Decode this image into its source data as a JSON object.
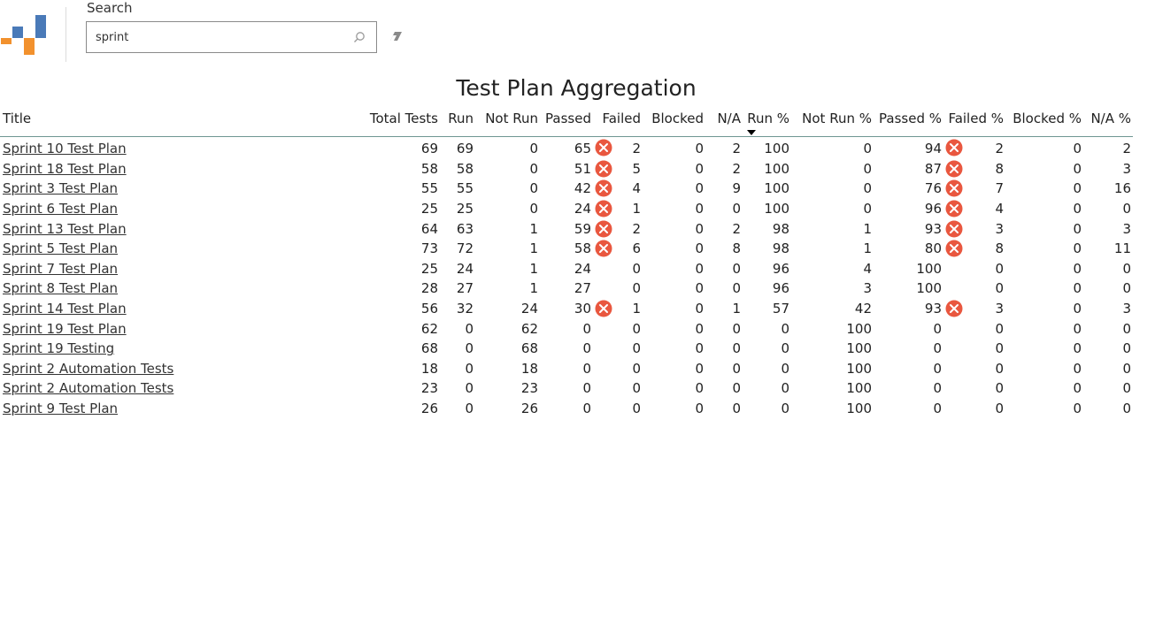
{
  "search": {
    "label": "Search",
    "value": "sprint"
  },
  "report": {
    "title": "Test Plan Aggregation"
  },
  "colors": {
    "logo_blue": "#4a7ab8",
    "logo_orange": "#f2912d",
    "fail_icon": "#e9573f",
    "header_rule": "#6f9693"
  },
  "table": {
    "sorted_column": "Run %",
    "columns": [
      "Title",
      "Total Tests",
      "Run",
      "Not Run",
      "Passed",
      "Failed",
      "Blocked",
      "N/A",
      "Run %",
      "Not Run %",
      "Passed %",
      "Failed %",
      "Blocked %",
      "N/A %"
    ],
    "rows": [
      {
        "title": "Sprint 10 Test Plan",
        "total": "69",
        "run": "69",
        "not_run": "0",
        "passed": "65",
        "failed": "2",
        "blocked": "0",
        "na": "2",
        "run_pct": "100",
        "not_run_pct": "0",
        "passed_pct": "94",
        "failed_pct": "2",
        "blocked_pct": "0",
        "na_pct": "2",
        "fail_icon": true
      },
      {
        "title": "Sprint 18 Test Plan",
        "total": "58",
        "run": "58",
        "not_run": "0",
        "passed": "51",
        "failed": "5",
        "blocked": "0",
        "na": "2",
        "run_pct": "100",
        "not_run_pct": "0",
        "passed_pct": "87",
        "failed_pct": "8",
        "blocked_pct": "0",
        "na_pct": "3",
        "fail_icon": true
      },
      {
        "title": "Sprint 3 Test Plan",
        "total": "55",
        "run": "55",
        "not_run": "0",
        "passed": "42",
        "failed": "4",
        "blocked": "0",
        "na": "9",
        "run_pct": "100",
        "not_run_pct": "0",
        "passed_pct": "76",
        "failed_pct": "7",
        "blocked_pct": "0",
        "na_pct": "16",
        "fail_icon": true
      },
      {
        "title": "Sprint 6 Test Plan",
        "total": "25",
        "run": "25",
        "not_run": "0",
        "passed": "24",
        "failed": "1",
        "blocked": "0",
        "na": "0",
        "run_pct": "100",
        "not_run_pct": "0",
        "passed_pct": "96",
        "failed_pct": "4",
        "blocked_pct": "0",
        "na_pct": "0",
        "fail_icon": true
      },
      {
        "title": "Sprint 13 Test Plan",
        "total": "64",
        "run": "63",
        "not_run": "1",
        "passed": "59",
        "failed": "2",
        "blocked": "0",
        "na": "2",
        "run_pct": "98",
        "not_run_pct": "1",
        "passed_pct": "93",
        "failed_pct": "3",
        "blocked_pct": "0",
        "na_pct": "3",
        "fail_icon": true
      },
      {
        "title": "Sprint 5 Test Plan",
        "total": "73",
        "run": "72",
        "not_run": "1",
        "passed": "58",
        "failed": "6",
        "blocked": "0",
        "na": "8",
        "run_pct": "98",
        "not_run_pct": "1",
        "passed_pct": "80",
        "failed_pct": "8",
        "blocked_pct": "0",
        "na_pct": "11",
        "fail_icon": true
      },
      {
        "title": "Sprint 7 Test Plan",
        "total": "25",
        "run": "24",
        "not_run": "1",
        "passed": "24",
        "failed": "0",
        "blocked": "0",
        "na": "0",
        "run_pct": "96",
        "not_run_pct": "4",
        "passed_pct": "100",
        "failed_pct": "0",
        "blocked_pct": "0",
        "na_pct": "0",
        "fail_icon": false
      },
      {
        "title": "Sprint 8 Test Plan",
        "total": "28",
        "run": "27",
        "not_run": "1",
        "passed": "27",
        "failed": "0",
        "blocked": "0",
        "na": "0",
        "run_pct": "96",
        "not_run_pct": "3",
        "passed_pct": "100",
        "failed_pct": "0",
        "blocked_pct": "0",
        "na_pct": "0",
        "fail_icon": false
      },
      {
        "title": "Sprint 14 Test Plan",
        "total": "56",
        "run": "32",
        "not_run": "24",
        "passed": "30",
        "failed": "1",
        "blocked": "0",
        "na": "1",
        "run_pct": "57",
        "not_run_pct": "42",
        "passed_pct": "93",
        "failed_pct": "3",
        "blocked_pct": "0",
        "na_pct": "3",
        "fail_icon": true
      },
      {
        "title": "Sprint 19 Test Plan",
        "total": "62",
        "run": "0",
        "not_run": "62",
        "passed": "0",
        "failed": "0",
        "blocked": "0",
        "na": "0",
        "run_pct": "0",
        "not_run_pct": "100",
        "passed_pct": "0",
        "failed_pct": "0",
        "blocked_pct": "0",
        "na_pct": "0",
        "fail_icon": false
      },
      {
        "title": "Sprint 19 Testing",
        "total": "68",
        "run": "0",
        "not_run": "68",
        "passed": "0",
        "failed": "0",
        "blocked": "0",
        "na": "0",
        "run_pct": "0",
        "not_run_pct": "100",
        "passed_pct": "0",
        "failed_pct": "0",
        "blocked_pct": "0",
        "na_pct": "0",
        "fail_icon": false
      },
      {
        "title": "Sprint 2 Automation Tests",
        "total": "18",
        "run": "0",
        "not_run": "18",
        "passed": "0",
        "failed": "0",
        "blocked": "0",
        "na": "0",
        "run_pct": "0",
        "not_run_pct": "100",
        "passed_pct": "0",
        "failed_pct": "0",
        "blocked_pct": "0",
        "na_pct": "0",
        "fail_icon": false
      },
      {
        "title": "Sprint 2 Automation Tests",
        "total": "23",
        "run": "0",
        "not_run": "23",
        "passed": "0",
        "failed": "0",
        "blocked": "0",
        "na": "0",
        "run_pct": "0",
        "not_run_pct": "100",
        "passed_pct": "0",
        "failed_pct": "0",
        "blocked_pct": "0",
        "na_pct": "0",
        "fail_icon": false
      },
      {
        "title": "Sprint 9 Test Plan",
        "total": "26",
        "run": "0",
        "not_run": "26",
        "passed": "0",
        "failed": "0",
        "blocked": "0",
        "na": "0",
        "run_pct": "0",
        "not_run_pct": "100",
        "passed_pct": "0",
        "failed_pct": "0",
        "blocked_pct": "0",
        "na_pct": "0",
        "fail_icon": false
      }
    ]
  }
}
